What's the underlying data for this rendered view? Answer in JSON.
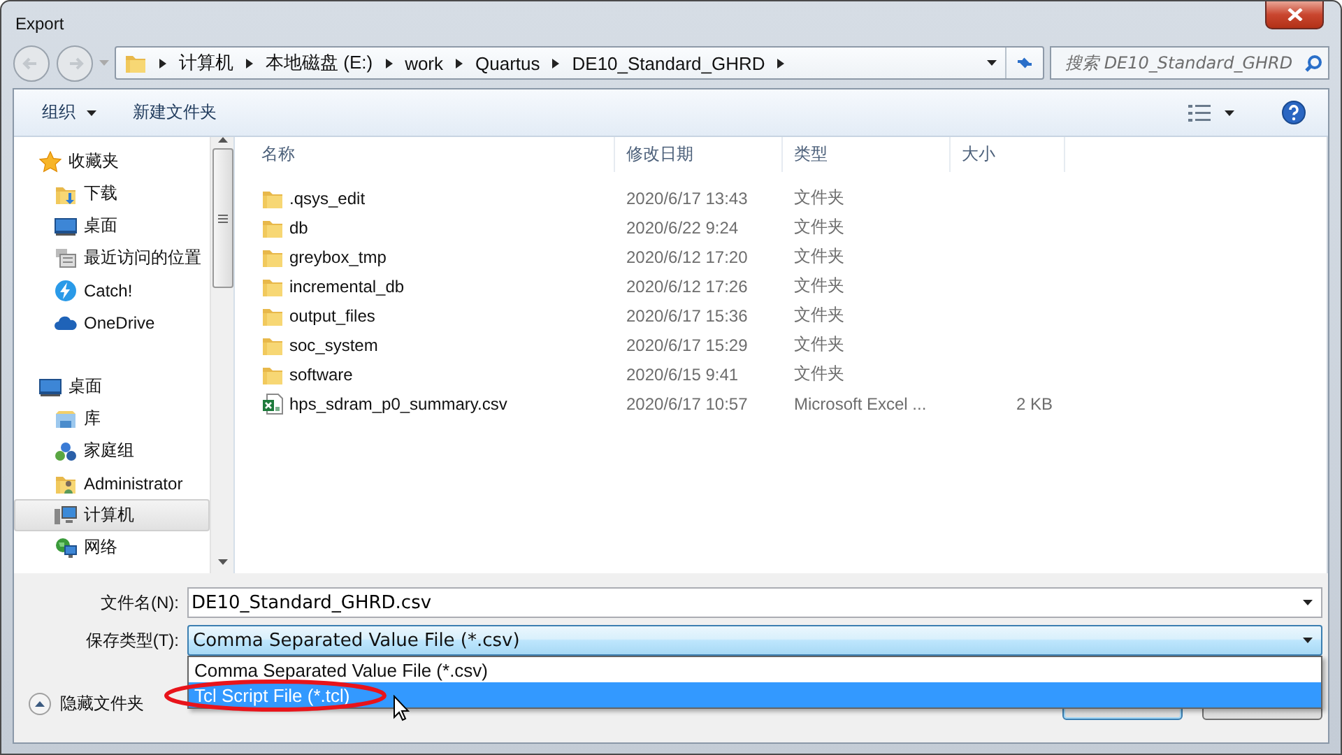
{
  "window": {
    "title": "Export"
  },
  "address": {
    "breadcrumbs": [
      "计算机",
      "本地磁盘 (E:)",
      "work",
      "Quartus",
      "DE10_Standard_GHRD"
    ]
  },
  "search": {
    "placeholder": "搜索 DE10_Standard_GHRD"
  },
  "toolbar": {
    "items": [
      {
        "label": "组织",
        "kind": "menu"
      },
      {
        "label": "新建文件夹",
        "kind": "button"
      }
    ]
  },
  "sidebar": {
    "groups": [
      {
        "label": "收藏夹",
        "kind": "star",
        "selected": false,
        "children": [
          {
            "label": "下载",
            "kind": "downloads",
            "selected": false
          },
          {
            "label": "桌面",
            "kind": "desktop",
            "selected": false
          },
          {
            "label": "最近访问的位置",
            "kind": "recent",
            "selected": false
          },
          {
            "label": "Catch!",
            "kind": "bolt",
            "selected": false
          },
          {
            "label": "OneDrive",
            "kind": "cloud",
            "selected": false
          }
        ]
      },
      {
        "label": "桌面",
        "kind": "desktop",
        "selected": false,
        "children": [
          {
            "label": "库",
            "kind": "library",
            "selected": false
          },
          {
            "label": "家庭组",
            "kind": "homegroup",
            "selected": false
          },
          {
            "label": "Administrator",
            "kind": "user",
            "selected": false
          },
          {
            "label": "计算机",
            "kind": "computer",
            "selected": true
          },
          {
            "label": "网络",
            "kind": "network",
            "selected": false
          }
        ]
      }
    ]
  },
  "table": {
    "columns": [
      "名称",
      "修改日期",
      "类型",
      "大小"
    ],
    "rows": [
      {
        "kind": "folder",
        "name": ".qsys_edit",
        "date": "2020/6/17 13:43",
        "type": "文件夹"
      },
      {
        "kind": "folder",
        "name": "db",
        "date": "2020/6/22 9:24",
        "type": "文件夹"
      },
      {
        "kind": "folder",
        "name": "greybox_tmp",
        "date": "2020/6/12 17:20",
        "type": "文件夹"
      },
      {
        "kind": "folder",
        "name": "incremental_db",
        "date": "2020/6/12 17:26",
        "type": "文件夹"
      },
      {
        "kind": "folder",
        "name": "output_files",
        "date": "2020/6/17 15:36",
        "type": "文件夹"
      },
      {
        "kind": "folder",
        "name": "soc_system",
        "date": "2020/6/17 15:29",
        "type": "文件夹"
      },
      {
        "kind": "folder",
        "name": "software",
        "date": "2020/6/15 9:41",
        "type": "文件夹"
      },
      {
        "kind": "excel",
        "name": "hps_sdram_p0_summary.csv",
        "date": "2020/6/17 10:57",
        "type": "Microsoft Excel ...",
        "size": "2 KB"
      }
    ]
  },
  "save": {
    "filename_label": "文件名(N):",
    "filename": "DE10_Standard_GHRD.csv",
    "type_label": "保存类型(T):",
    "type_value": "Comma Separated Value File (*.csv)",
    "options": [
      {
        "label": "Comma Separated Value File (*.csv)",
        "selected": false,
        "circled": false
      },
      {
        "label": "Tcl Script File (*.tcl)",
        "selected": true,
        "circled": true
      }
    ]
  },
  "hide_folders": {
    "label": "隐藏文件夹"
  }
}
